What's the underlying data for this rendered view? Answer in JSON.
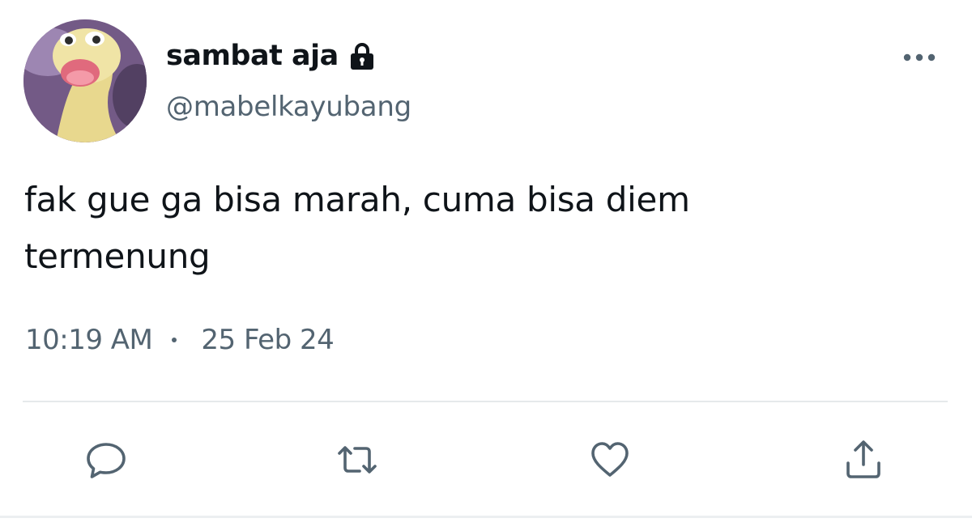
{
  "user": {
    "display_name": "sambat aja",
    "handle": "@mabelkayubang",
    "protected_icon": "lock-icon",
    "avatar_icon": "avatar-image"
  },
  "tweet": {
    "text_lines": [
      "fak gue ga bisa marah, cuma bisa diem",
      "termenung"
    ],
    "time": "10:19 AM",
    "date": "25 Feb 24"
  },
  "actions": {
    "more": "more-options-icon",
    "reply": "reply-icon",
    "retweet": "retweet-icon",
    "like": "like-icon",
    "share": "share-icon"
  },
  "colors": {
    "text_primary": "#0f1419",
    "text_secondary": "#536471",
    "divider": "#e6e9eb"
  }
}
